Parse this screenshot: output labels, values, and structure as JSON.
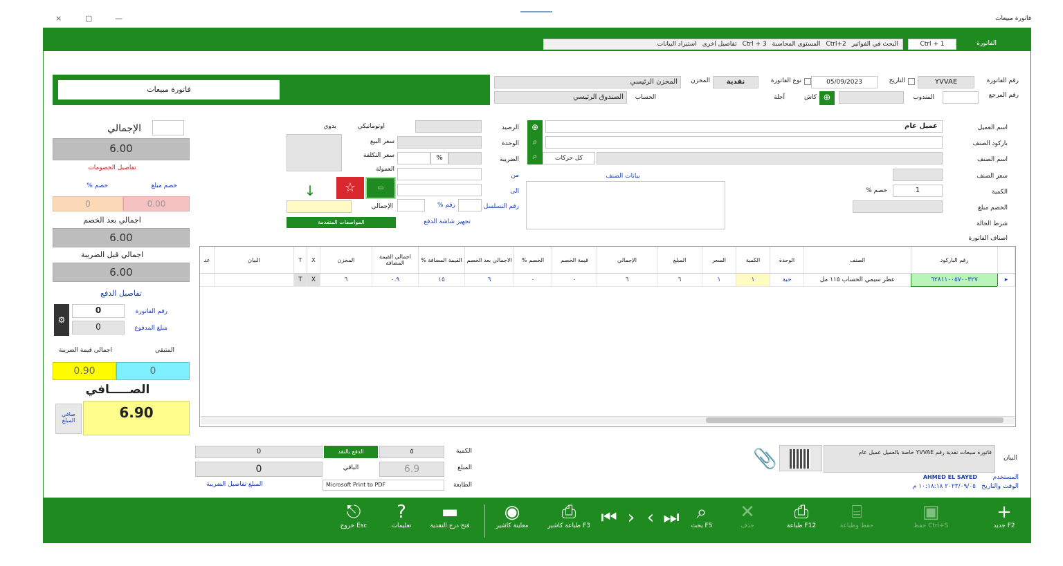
{
  "window": {
    "title": "فاتورة مبيعات",
    "controls": [
      "×",
      "▢",
      "—"
    ]
  },
  "menu": {
    "invoice_label": "الفاتورة",
    "ctrl1": "Ctrl + 1",
    "shortcuts": [
      "البحث في الفواتير",
      "Ctrl+2",
      "المستوى المحاسبة",
      "Ctrl + 3",
      "تفاصيل اخرى",
      "استيراد البيانات"
    ]
  },
  "header": {
    "doc_title": "فاتورة مبيعات",
    "invoice_no_label": "رقم الفاتورة",
    "invoice_no": "YVVAE",
    "date_label": "التاريخ",
    "date": "05/09/2023",
    "invoice_type_label": "نوع الفاتورة",
    "invoice_type": "نقدية",
    "store_label": "المخزن",
    "store": "المخزن الرئيسي",
    "ref_label": "رقم المرجع",
    "rep_label": "المندوب",
    "account_label": "الحساب",
    "account": "الصندوق الرئيسي",
    "pay_cash": "كاش",
    "pay_credit": "آجلة"
  },
  "left": {
    "total_label": "الإجمالي",
    "total": "6.00",
    "discount_details": "تفاصيل الخصومات",
    "disc_pct_label": "خصم %",
    "disc_amt_label": "خصم مبلغ",
    "disc_pct": "0",
    "disc_amt": "0.00",
    "after_disc_label": "اجمالي بعد الخصم",
    "after_disc": "6.00",
    "before_tax_label": "اجمالي قبل الضريبة",
    "before_tax": "6.00",
    "payment_details": "تفاصيل الدفع",
    "inv_no_label": "رقم الفاتورة",
    "inv_no_val": "0",
    "paid_label": "مبلغ المدفوع",
    "paid_val": "0",
    "tax_total_label": "اجمالي قيمة الضريبة",
    "rest_label": "المتبقي",
    "tax_total": "0.90",
    "rest": "0",
    "net_label": "الصـــــافي",
    "net": "6.90",
    "net_side": "صافي المبلغ"
  },
  "item": {
    "client_label": "اسم العميل",
    "client": "عميل عام",
    "barcode_label": "باركود الصنف",
    "item_name_label": "اسم الصنف",
    "price_label": "سعر الصنف",
    "qty_label": "الكمية",
    "qty": "1",
    "disc_label": "الخصم مبلغ",
    "disc_pct_label": "خصم %",
    "note_label": "شرط الحالة",
    "stores_label": "اصناف الفاتورة",
    "balance_label": "الرصيد",
    "unit_label": "الوحدة",
    "tax_label": "الضريبة",
    "tax_value": "كل حركات",
    "item_info": "بيانات الصنف",
    "auto_label": "اوتوماتيكي",
    "manual_label": "يدوي",
    "total_field_label": "الإجمالي",
    "options_button": "المواصفات المتقدمة",
    "print_check": "تجهيز شاشة الدفع",
    "print_sale_label": "سعر البيع",
    "cost_label": "سعر التكلفة",
    "profit_label": "العمولة",
    "pct_symbol": "%",
    "from_label": "من",
    "to_label": "الى",
    "serial_label": "رقم التسلسل",
    "disc_row_label": "رقم %"
  },
  "grid": {
    "headers": [
      "رقم الباركود",
      "الصنف",
      "الوحدة",
      "الكمية",
      "السعر",
      "المبلغ",
      "الإجمالي",
      "قيمة الخصم",
      "الخصم %",
      "الاجمالي بعد الخصم",
      "القيمة المضافة %",
      "اجمالي القيمة المضافة",
      "المخزن",
      "X",
      "T",
      "البيان",
      "عد"
    ],
    "rows": [
      [
        "٦٢٨١١٠٠٥٧٠٠٣٢٧",
        "عطر سيمي الحساب ١١٥ مل",
        "حبة",
        "١",
        "١",
        "٦",
        "٦",
        "٠",
        "٠",
        "٦",
        "١٥",
        "٠.٩",
        "٦",
        "X",
        "T",
        "",
        ""
      ]
    ]
  },
  "bottom": {
    "qty_label": "الكمية",
    "qty_val": "٥",
    "amount_label": "المبلغ",
    "amount_val": "6.9",
    "printer_label": "الطابعة",
    "printer": "Microsoft Print to PDF",
    "green_btn": "الدفع بالنقد",
    "remaining_label": "الباقي",
    "remaining_val": "0",
    "zero_val": "0",
    "link": "المبلغ تفاصيل الضريبة",
    "notes_label": "البيان",
    "notes": "فاتورة مبيعات نقدية رقم YVVAE خاصة بالعميل عميل عام",
    "user_label": "المستخدم",
    "user": "AHMED EL SAYED",
    "datetime_label": "الوقت والتاريخ",
    "datetime": "٢٠٢٣/٠٩/٠٥ ١٠:١٨:١٨ م"
  },
  "toolbar": {
    "new": "جديد F2",
    "save": "حفظ Ctrl+S",
    "save_print": "حفظ وطباعة",
    "print": "طباعة F12",
    "delete": "حذف",
    "search": "بحث F5",
    "print_a4": "طباعة كاشير F3",
    "preview": "معاينة كاشير",
    "open_drawer": "فتح درج النقدية",
    "help": "تعليمات",
    "exit": "خروج Esc"
  },
  "colors": {
    "green": "#1f8a1f",
    "yellow": "#fffd8c",
    "cyan": "#7ff0ff",
    "peach": "#fcd9b6",
    "pink": "#f6c1c1"
  }
}
